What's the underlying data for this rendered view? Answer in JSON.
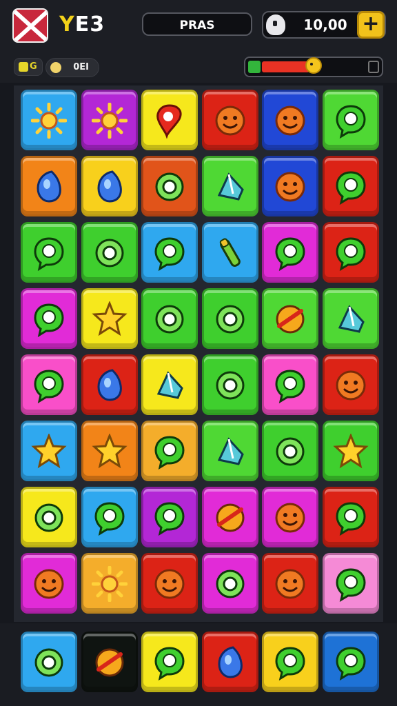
{
  "header": {
    "flag_icon": "union-flag-icon",
    "brand_prefix": "Y",
    "brand_rest": "E3",
    "center_label": "PRAS",
    "coins": "10,00",
    "plus_label": "+"
  },
  "subbar": {
    "badge_label": "G",
    "pill_label": "0EI",
    "energy_level": 0.46
  },
  "colors": {
    "blue": "#2fa8ef",
    "purple": "#b327d6",
    "yellow": "#f6e81c",
    "red": "#dc2316",
    "royal": "#2148d6",
    "lime": "#4fd834",
    "orange": "#f28418",
    "gold": "#f8d01c",
    "burnt": "#e1541a",
    "green": "#3fcf2e",
    "magenta": "#e12bd7",
    "pink": "#f94fc9",
    "mango": "#f4ad2b",
    "lightpink": "#f58ad6",
    "darkblue": "#1e72d6"
  },
  "board": [
    [
      {
        "c": "blue",
        "i": "sun"
      },
      {
        "c": "purple",
        "i": "sun"
      },
      {
        "c": "yellow",
        "i": "pin"
      },
      {
        "c": "red",
        "i": "face"
      },
      {
        "c": "royal",
        "i": "face"
      },
      {
        "c": "lime",
        "i": "bubble"
      }
    ],
    [
      {
        "c": "orange",
        "i": "drop"
      },
      {
        "c": "gold",
        "i": "drop"
      },
      {
        "c": "burnt",
        "i": "ring"
      },
      {
        "c": "lime",
        "i": "gem"
      },
      {
        "c": "royal",
        "i": "face"
      },
      {
        "c": "red",
        "i": "bubble"
      }
    ],
    [
      {
        "c": "green",
        "i": "bubble"
      },
      {
        "c": "green",
        "i": "ring"
      },
      {
        "c": "blue",
        "i": "bubble"
      },
      {
        "c": "blue",
        "i": "tube"
      },
      {
        "c": "magenta",
        "i": "bubble"
      },
      {
        "c": "red",
        "i": "bubble"
      }
    ],
    [
      {
        "c": "magenta",
        "i": "bubble"
      },
      {
        "c": "yellow",
        "i": "star"
      },
      {
        "c": "green",
        "i": "ring"
      },
      {
        "c": "green",
        "i": "ring"
      },
      {
        "c": "lime",
        "i": "ball"
      },
      {
        "c": "lime",
        "i": "gem"
      }
    ],
    [
      {
        "c": "pink",
        "i": "bubble"
      },
      {
        "c": "red",
        "i": "drop"
      },
      {
        "c": "yellow",
        "i": "gem"
      },
      {
        "c": "green",
        "i": "ring"
      },
      {
        "c": "pink",
        "i": "bubble"
      },
      {
        "c": "red",
        "i": "face"
      }
    ],
    [
      {
        "c": "blue",
        "i": "star"
      },
      {
        "c": "orange",
        "i": "star"
      },
      {
        "c": "mango",
        "i": "bubble"
      },
      {
        "c": "lime",
        "i": "gem"
      },
      {
        "c": "green",
        "i": "ring"
      },
      {
        "c": "green",
        "i": "star"
      }
    ],
    [
      {
        "c": "yellow",
        "i": "ring"
      },
      {
        "c": "blue",
        "i": "bubble"
      },
      {
        "c": "purple",
        "i": "bubble"
      },
      {
        "c": "magenta",
        "i": "ball"
      },
      {
        "c": "magenta",
        "i": "face"
      },
      {
        "c": "red",
        "i": "bubble"
      }
    ],
    [
      {
        "c": "magenta",
        "i": "face"
      },
      {
        "c": "mango",
        "i": "sun"
      },
      {
        "c": "red",
        "i": "face"
      },
      {
        "c": "magenta",
        "i": "ring"
      },
      {
        "c": "red",
        "i": "face"
      },
      {
        "c": "lightpink",
        "i": "bubble"
      }
    ]
  ],
  "tray": [
    {
      "c": "blue",
      "i": "ring"
    },
    {
      "c": "black",
      "i": "ball"
    },
    {
      "c": "yellow",
      "i": "bubble"
    },
    {
      "c": "red",
      "i": "drop"
    },
    {
      "c": "gold",
      "i": "bubble"
    },
    {
      "c": "darkblue",
      "i": "bubble"
    }
  ]
}
